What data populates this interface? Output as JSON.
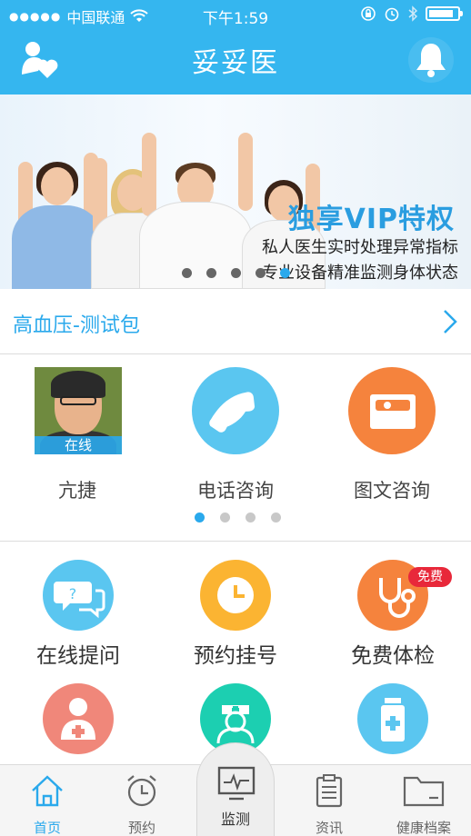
{
  "status_bar": {
    "carrier": "中国联通",
    "time": "下午1:59"
  },
  "header": {
    "title": "妥妥医"
  },
  "banner": {
    "title": "独享VIP特权",
    "line1": "私人医生实时处理异常指标",
    "line2": "专业设备精准监测身体状态",
    "active_index": 3,
    "page_count": 5
  },
  "package": {
    "label": "高血压-测试包"
  },
  "consult": {
    "doctor_name": "亢捷",
    "online_label": "在线",
    "phone_label": "电话咨询",
    "text_label": "图文咨询",
    "active_index": 0,
    "page_count": 4
  },
  "services": {
    "ask": "在线提问",
    "appointment": "预约挂号",
    "checkup": "免费体检",
    "free_badge": "免费"
  },
  "tabbar": {
    "home": "首页",
    "booking": "预约",
    "monitor": "监测",
    "news": "资讯",
    "records": "健康档案"
  },
  "colors": {
    "brand_blue": "#35b6ef",
    "accent_blue": "#2aa9ec",
    "orange": "#f5833d",
    "yellow": "#fbb432",
    "pink": "#f0877a",
    "teal": "#1ccfb1",
    "light_blue": "#5ac6f0",
    "badge_red": "#e8283a"
  }
}
